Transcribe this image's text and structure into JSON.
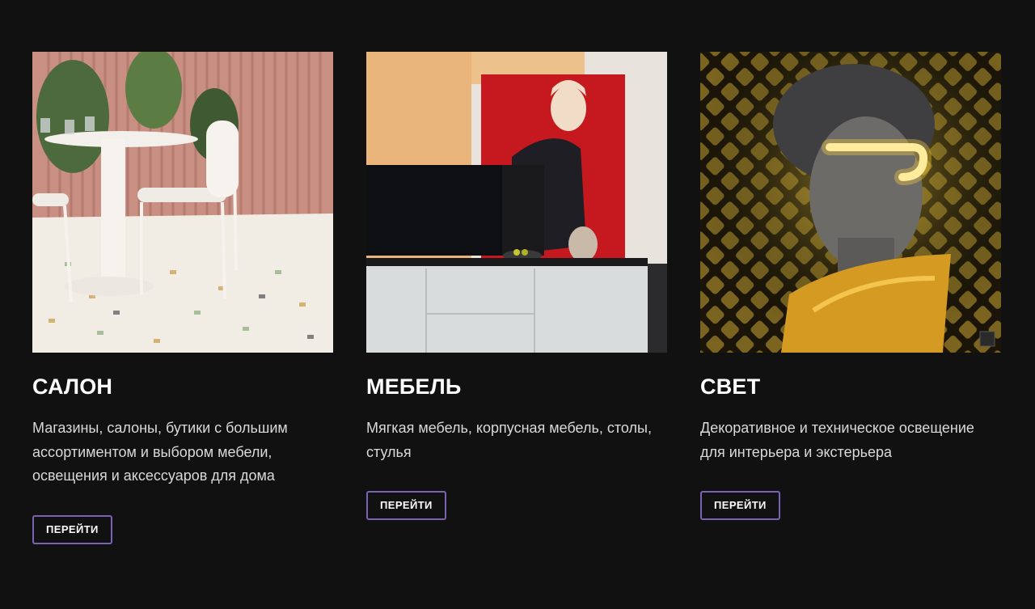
{
  "cards": [
    {
      "image": "salon-interior-photo",
      "title": "САЛОН",
      "description": "Магазины, салоны, бутики с большим ассортиментом и выбором мебели, освещения и аксессуаров для дома",
      "button_label": "ПЕРЕЙТИ"
    },
    {
      "image": "furniture-room-photo",
      "title": "МЕБЕЛЬ",
      "description": "Мягкая мебель, корпусная мебель, столы, стулья",
      "button_label": "ПЕРЕЙТИ"
    },
    {
      "image": "neon-bust-light-photo",
      "title": "СВЕТ",
      "description": "Декоративное и техническое освещение для интерьера и экстерьера",
      "button_label": "ПЕРЕЙТИ"
    }
  ],
  "colors": {
    "background": "#111112",
    "button_border": "#7c61b3",
    "text": "#ffffff",
    "description_text": "#d9d9d9"
  }
}
